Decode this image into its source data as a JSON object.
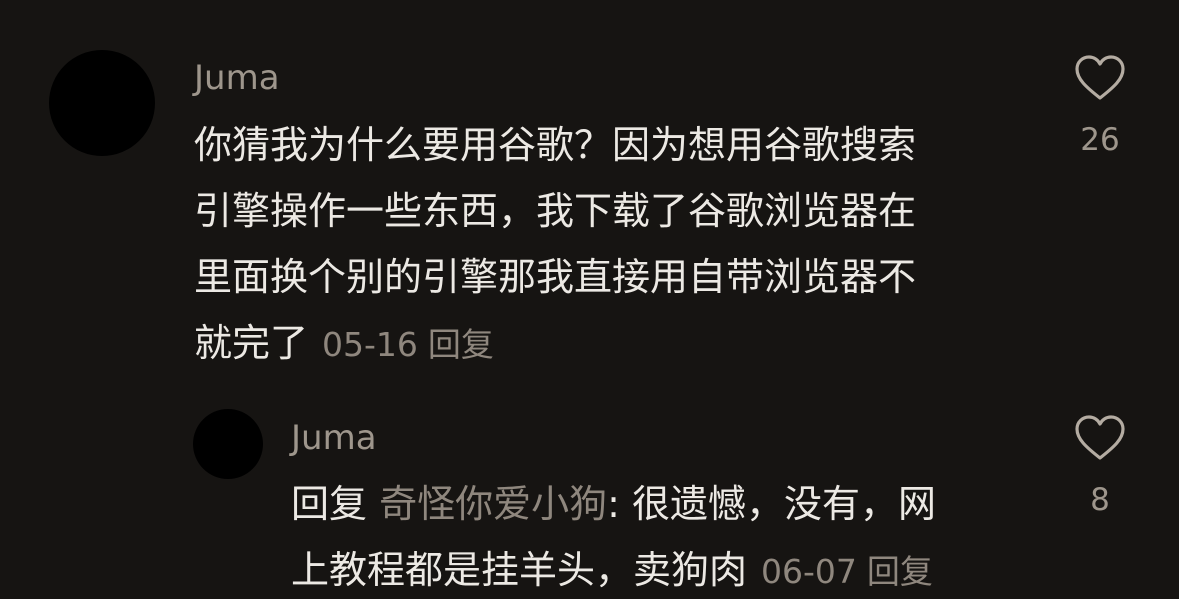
{
  "comments": [
    {
      "username": "Juma",
      "lines": [
        "你猜我为什么要用谷歌？因为想用谷歌搜索",
        "引擎操作一些东西，我下载了谷歌浏览器在",
        "里面换个别的引擎那我直接用自带浏览器不",
        "就完了"
      ],
      "date": "05-16",
      "reply_label": "回复",
      "like_count": "26",
      "like_icon": "heart-outline-icon"
    }
  ],
  "replies": [
    {
      "username": "Juma",
      "reply_prefix": "回复",
      "mention": "奇怪你爱小狗",
      "line1_text": ": 很遗憾，没有，网",
      "line2_text": "上教程都是挂羊头，卖狗肉",
      "date": "06-07",
      "reply_label": "回复",
      "like_count": "8",
      "like_icon": "heart-outline-icon"
    }
  ],
  "colors": {
    "background": "#161412",
    "text_primary": "#ece9e4",
    "text_secondary": "#9e968c",
    "avatar": "#000000"
  }
}
